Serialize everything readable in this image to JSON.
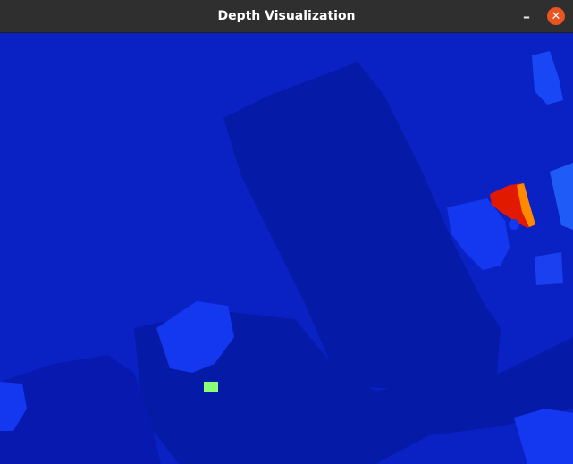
{
  "window": {
    "title": "Depth Visualization",
    "minimize_symbol": "–",
    "close_symbol": "✕",
    "titlebar_color": "#2f2f2f",
    "close_color": "#e95420"
  },
  "icons": [
    "minimize-icon",
    "close-icon"
  ],
  "depth_colors": {
    "background": "#0a22c4",
    "dark_region": "#061aa8",
    "mid_blue": "#1438ef",
    "light_blue": "#1f5cf7",
    "near_red": "#e01900",
    "near_orange": "#ff8a00",
    "green_speck": "#8aff7a"
  }
}
